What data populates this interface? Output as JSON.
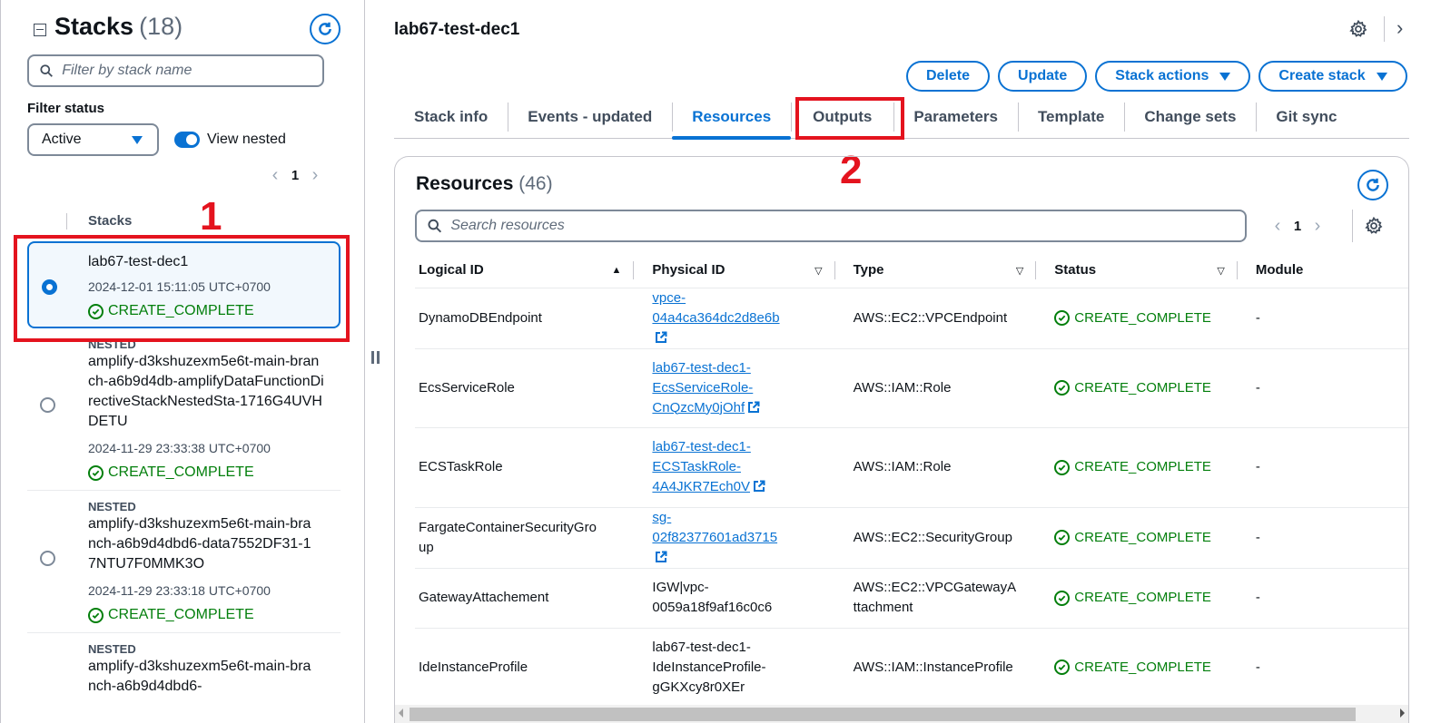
{
  "left_panel": {
    "title": "Stacks",
    "count": "(18)",
    "search_placeholder": "Filter by stack name",
    "filter_label": "Filter status",
    "filter_value": "Active",
    "toggle_label": "View nested",
    "toggle_on": true,
    "page": "1",
    "column_header": "Stacks",
    "stacks": [
      {
        "nested": "",
        "name": "lab67-test-dec1",
        "date": "2024-12-01 15:11:05 UTC+0700",
        "status": "CREATE_COMPLETE",
        "selected": true
      },
      {
        "nested": "NESTED",
        "name": "amplify-d3kshuzexm5e6t-main-branch-a6b9d4db-amplifyDataFunctionDirectiveStackNestedSta-1716G4UVHDETU",
        "date": "2024-11-29 23:33:38 UTC+0700",
        "status": "CREATE_COMPLETE",
        "selected": false
      },
      {
        "nested": "NESTED",
        "name": "amplify-d3kshuzexm5e6t-main-branch-a6b9d4dbd6-data7552DF31-17NTU7F0MMK3O",
        "date": "2024-11-29 23:33:18 UTC+0700",
        "status": "CREATE_COMPLETE",
        "selected": false
      },
      {
        "nested": "NESTED",
        "name": "amplify-d3kshuzexm5e6t-main-branch-a6b9d4dbd6-",
        "date": "",
        "status": "",
        "selected": false
      }
    ]
  },
  "header": {
    "title": "lab67-test-dec1",
    "buttons": {
      "delete": "Delete",
      "update": "Update",
      "stack_actions": "Stack actions",
      "create_stack": "Create stack"
    }
  },
  "tabs": [
    {
      "label": "Stack info",
      "active": false
    },
    {
      "label": "Events - updated",
      "active": false
    },
    {
      "label": "Resources",
      "active": true
    },
    {
      "label": "Outputs",
      "active": false
    },
    {
      "label": "Parameters",
      "active": false
    },
    {
      "label": "Template",
      "active": false
    },
    {
      "label": "Change sets",
      "active": false
    },
    {
      "label": "Git sync",
      "active": false
    }
  ],
  "annotations": {
    "one": "1",
    "two": "2"
  },
  "resources": {
    "title": "Resources",
    "count": "(46)",
    "search_placeholder": "Search resources",
    "page": "1",
    "columns": [
      "Logical ID",
      "Physical ID",
      "Type",
      "Status",
      "Module"
    ],
    "rows": [
      {
        "logical_id": "DynamoDBEndpoint",
        "physical_id": "vpce-04a4ca364dc2d8e6b",
        "physical_link": true,
        "type": "AWS::EC2::VPCEndpoint",
        "status": "CREATE_COMPLETE",
        "module": "-"
      },
      {
        "logical_id": "EcsServiceRole",
        "physical_id": "lab67-test-dec1-EcsServiceRole-CnQzcMy0jOhf",
        "physical_link": true,
        "type": "AWS::IAM::Role",
        "status": "CREATE_COMPLETE",
        "module": "-"
      },
      {
        "logical_id": "ECSTaskRole",
        "physical_id": "lab67-test-dec1-ECSTaskRole-4A4JKR7Ech0V",
        "physical_link": true,
        "type": "AWS::IAM::Role",
        "status": "CREATE_COMPLETE",
        "module": "-"
      },
      {
        "logical_id": "FargateContainerSecurityGroup",
        "physical_id": "sg-02f82377601ad3715",
        "physical_link": true,
        "type": "AWS::EC2::SecurityGroup",
        "status": "CREATE_COMPLETE",
        "module": "-"
      },
      {
        "logical_id": "GatewayAttachement",
        "physical_id": "IGW|vpc-0059a18f9af16c0c6",
        "physical_link": false,
        "type": "AWS::EC2::VPCGatewayAttachment",
        "status": "CREATE_COMPLETE",
        "module": "-"
      },
      {
        "logical_id": "IdeInstanceProfile",
        "physical_id": "lab67-test-dec1-IdeInstanceProfile-gGKXcy8r0XEr",
        "physical_link": false,
        "type": "AWS::IAM::InstanceProfile",
        "status": "CREATE_COMPLETE",
        "module": "-"
      }
    ]
  },
  "colors": {
    "accent": "#0972d3",
    "success": "#037f0c",
    "annotation": "#e4131e"
  }
}
